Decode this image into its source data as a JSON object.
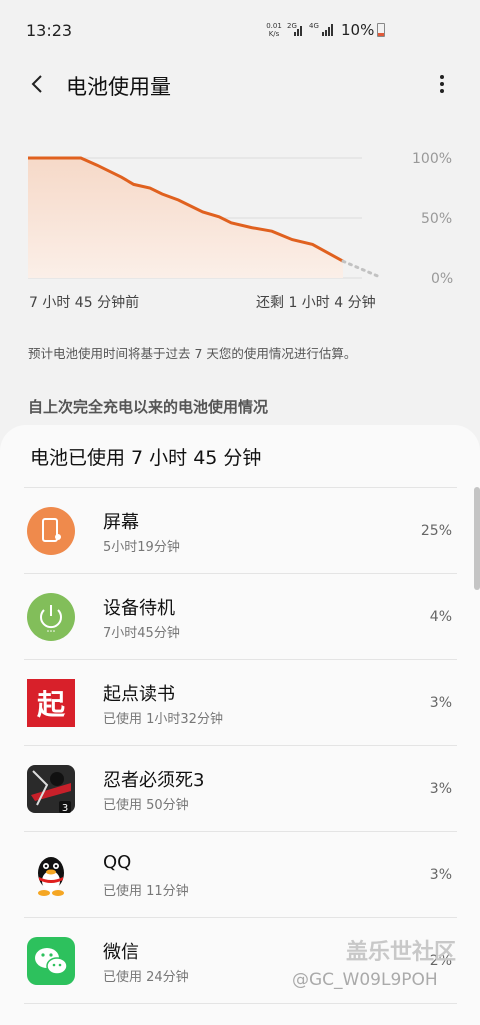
{
  "status_bar": {
    "time": "13:23",
    "net_speed_value": "0.01",
    "net_speed_unit": "K/s",
    "signal_1": "2G",
    "signal_2": "4G",
    "battery_pct": "10%"
  },
  "header": {
    "title": "电池使用量"
  },
  "chart_data": {
    "type": "area",
    "x": [
      0,
      7.75,
      11.817
    ],
    "series": [
      {
        "values": [
          100,
          100,
          94,
          89,
          84,
          78,
          75,
          70,
          65,
          60,
          55,
          51,
          46,
          42,
          39,
          32,
          28,
          14
        ],
        "x_hours": [
          0,
          1.3,
          1.7,
          2.0,
          2.3,
          2.6,
          3.0,
          3.3,
          3.7,
          4.0,
          4.3,
          4.7,
          5.0,
          5.5,
          6.0,
          6.5,
          7.0,
          7.75
        ]
      },
      {
        "values": [
          14,
          0
        ]
      }
    ],
    "y_ticks": [
      "100%",
      "50%",
      "0%"
    ],
    "ylim": [
      0,
      100
    ],
    "xlabel_left": "7 小时 45 分钟前",
    "xlabel_right": "还剩 1 小时 4 分钟",
    "grid": true,
    "colors": {
      "line": "#e0611f",
      "fill": "#f6d9c8",
      "projection": "#c2c2c2"
    }
  },
  "estimate_note": "预计电池使用时间将基于过去 7 天您的使用情况进行估算。",
  "section_title": "自上次完全充电以来的电池使用情况",
  "card": {
    "heading": "电池已使用 7 小时 45 分钟",
    "apps": [
      {
        "name": "屏幕",
        "time": "5小时19分钟",
        "pct": "25%",
        "icon": "screen-icon",
        "color": "#ef8a4c"
      },
      {
        "name": "设备待机",
        "time": "7小时45分钟",
        "pct": "4%",
        "icon": "power-icon",
        "color": "#82be5a"
      },
      {
        "name": "起点读书",
        "time": "已使用 1小时32分钟",
        "pct": "3%",
        "icon": "qidian-icon",
        "color": "#d8202a",
        "glyph": "起"
      },
      {
        "name": "忍者必须死3",
        "time": "已使用 50分钟",
        "pct": "3%",
        "icon": "ninja-game-icon",
        "color": "#2a2a2a",
        "badge": "3"
      },
      {
        "name": "QQ",
        "time": "已使用 11分钟",
        "pct": "3%",
        "icon": "qq-penguin-icon",
        "color": "#111111"
      },
      {
        "name": "微信",
        "time": "已使用 24分钟",
        "pct": "2%",
        "icon": "wechat-icon",
        "color": "#2dc15d"
      }
    ]
  },
  "watermark": {
    "brand": "盖乐世社区",
    "user": "@GC_W09L9POH"
  }
}
